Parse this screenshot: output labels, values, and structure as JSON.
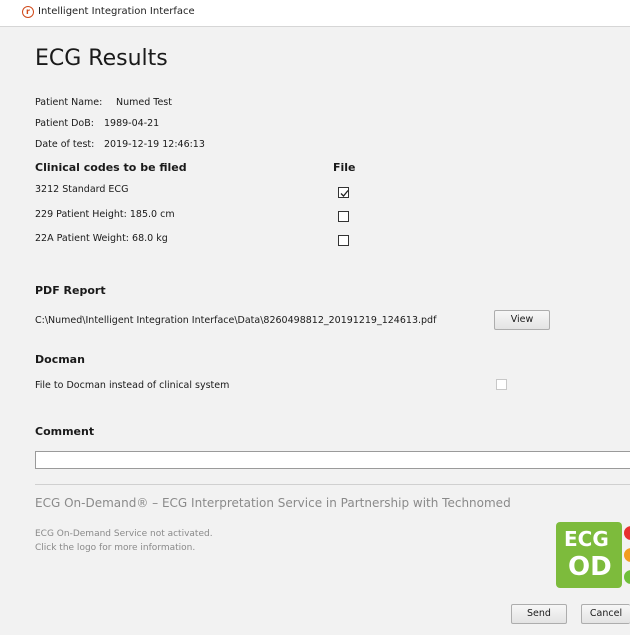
{
  "window": {
    "title": "Intelligent Integration Interface",
    "icon": "app-logo-icon"
  },
  "page_title": "ECG Results",
  "patient": {
    "name_label": "Patient Name:",
    "name_value": "Numed Test",
    "dob_label": "Patient DoB:",
    "dob_value": "1989-04-21",
    "test_label": "Date of test:",
    "test_value": "2019-12-19 12:46:13"
  },
  "codes": {
    "header": "Clinical codes to be filed",
    "file_header": "File",
    "items": [
      {
        "label": "3212 Standard ECG",
        "checked": true
      },
      {
        "label": "229 Patient Height: 185.0 cm",
        "checked": false
      },
      {
        "label": "22A Patient Weight: 68.0 kg",
        "checked": false
      }
    ]
  },
  "pdf": {
    "header": "PDF Report",
    "path": "C:\\Numed\\Intelligent Integration Interface\\Data\\8260498812_20191219_124613.pdf",
    "view_label": "View"
  },
  "docman": {
    "header": "Docman",
    "option_label": "File to Docman instead of clinical system",
    "checked": false
  },
  "comment": {
    "header": "Comment",
    "value": ""
  },
  "ecg_service": {
    "heading": "ECG On-Demand® – ECG Interpretation Service in Partnership with Technomed",
    "status_line1": "ECG On-Demand Service not activated.",
    "status_line2": "Click the logo for more information.",
    "logo_text_top": "ECG",
    "logo_text_bottom": "OD",
    "colors": {
      "logo_green": "#7dbb3c",
      "dot_red": "#e8312f",
      "dot_orange": "#f39c1f",
      "dot_green": "#6fbf3a"
    }
  },
  "actions": {
    "send_label": "Send",
    "cancel_label": "Cancel"
  }
}
